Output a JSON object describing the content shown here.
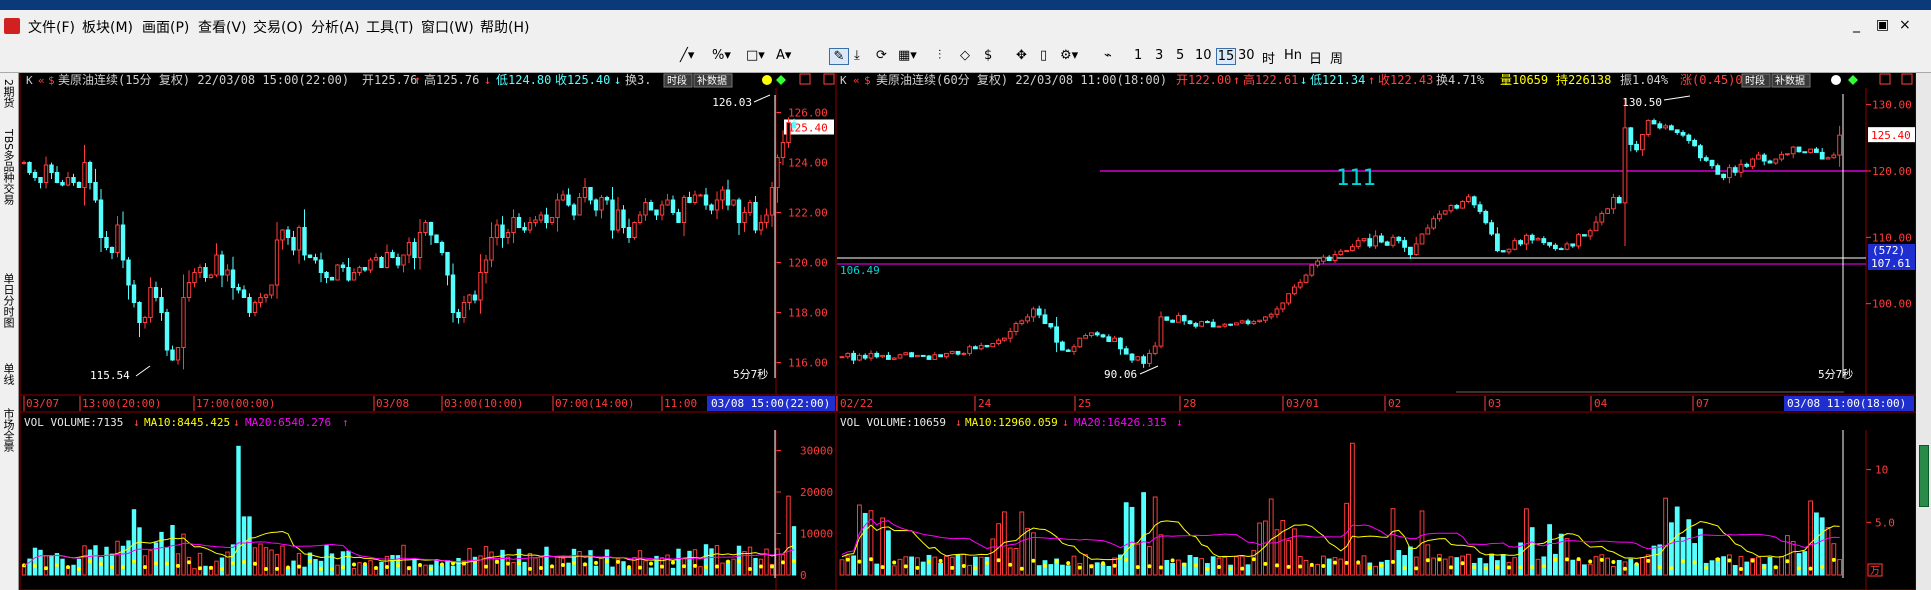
{
  "menu": [
    "文件(F)",
    "板块(M)",
    "画面(P)",
    "查看(V)",
    "交易(O)",
    "分析(A)",
    "工具(T)",
    "窗口(W)",
    "帮助(H)"
  ],
  "window_controls": [
    "_",
    "▣",
    "×"
  ],
  "toolbar": {
    "period_buttons": [
      "1",
      "3",
      "5",
      "10",
      "15",
      "30",
      "时",
      "Hn",
      "日",
      "周"
    ],
    "selected_period": "15",
    "currency_symbol": "$"
  },
  "sidebar_tabs": [
    "2期货",
    "TBS多品种交易",
    "单日分时图",
    "单线",
    "市场全景"
  ],
  "left_chart": {
    "header": {
      "title": "美原油连续(15分 复权) 22/03/08 15:00(22:00)",
      "open_label": "开125.76",
      "high_label": "高125.76",
      "low_label": "低124.80",
      "close_label": "收125.40",
      "turnover_label": "换3.",
      "btn_period": "时段",
      "btn_fill": "补数据"
    },
    "price_labels": [
      "126.00",
      "124.00",
      "122.00",
      "120.00",
      "118.00",
      "116.00"
    ],
    "current_price": "125.40",
    "high_annotation": "126.03",
    "low_annotation": "115.54",
    "countdown": "5分7秒",
    "time_labels": [
      "03/07",
      "13:00(20:00)",
      "17:00(00:00)",
      "03/08",
      "03:00(10:00)",
      "07:00(14:00)",
      "11:00"
    ],
    "time_cursor": "03/08 15:00(22:00)",
    "vol_header": {
      "vol": "VOL VOLUME:7135",
      "ma10": "MA10:8445.425",
      "ma20": "MA20:6540.276"
    },
    "vol_labels": [
      "30000",
      "20000",
      "10000",
      "0"
    ]
  },
  "right_chart": {
    "header": {
      "title": "美原油连续(60分 复权) 22/03/08 11:00(18:00)",
      "open_label": "开122.00",
      "high_label": "高122.61",
      "low_label": "低121.34",
      "close_label": "收122.43",
      "turnover_label": "换4.71%",
      "volume_label": "量10659",
      "hold_label": "持226138",
      "amp_label": "振1.04%",
      "change_label": "涨(0.45)0.",
      "btn_period": "时段",
      "btn_fill": "补数据"
    },
    "price_labels": [
      "130.00",
      "120.00",
      "110.00",
      "100.00"
    ],
    "current_price": "125.40",
    "line_price": "107.61",
    "line_count": "(572)",
    "high_annotation": "130.50",
    "low_annotation": "90.06",
    "line_label": "111",
    "left_level": "106.49",
    "countdown": "5分7秒",
    "time_labels": [
      "02/22",
      "24",
      "25",
      "28",
      "03/01",
      "02",
      "03",
      "04",
      "07"
    ],
    "time_cursor": "03/08 11:00(18:00)",
    "vol_header": {
      "vol": "VOL VOLUME:10659",
      "ma10": "MA10:12960.059",
      "ma20": "MA20:16426.315"
    },
    "vol_labels": [
      "10",
      "5.0"
    ],
    "vol_unit": "万"
  },
  "colors": {
    "up": "#ff3b3b",
    "down": "#54ffff",
    "grid_red": "#8b0000",
    "ma10": "#ffff00",
    "ma20": "#ff00ff",
    "line_magenta": "#ff00ff",
    "price_cyan": "#00d7d7"
  }
}
